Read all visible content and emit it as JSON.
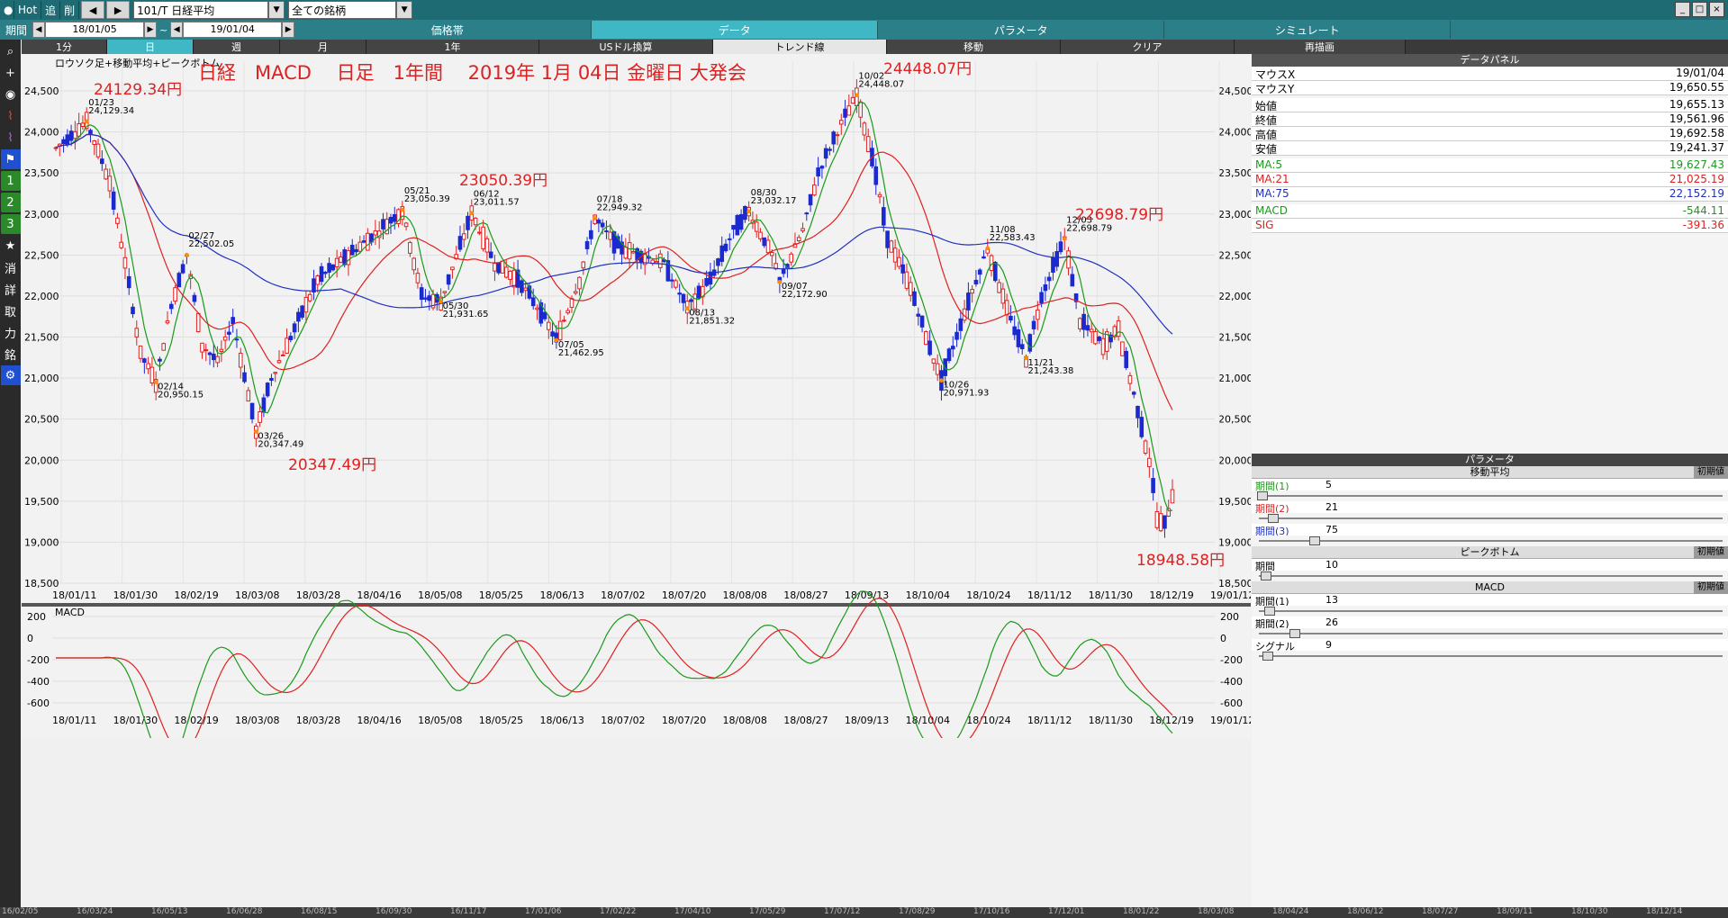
{
  "topbar": {
    "hot": "Hot",
    "add": "追",
    "del": "削",
    "symbol": "101/T 日経平均",
    "universe": "全ての銘柄",
    "win_min": "_",
    "win_max": "□",
    "win_close": "×"
  },
  "row2": {
    "period_label": "期間",
    "start_date": "18/01/05",
    "tilde": "~",
    "end_date": "19/01/04",
    "tabs": [
      "価格帯",
      "データ",
      "パラメータ",
      "シミュレート"
    ],
    "active_tab": 1
  },
  "row3": {
    "tabs": [
      "1分",
      "日",
      "週",
      "月",
      "1年",
      "USドル換算",
      "トレンド線",
      "移動",
      "クリア",
      "再描画"
    ],
    "active_tab": 1
  },
  "sidebar": {
    "icons": [
      "search-icon",
      "plus-icon",
      "camera-icon",
      "chart-icon",
      "chart-alt-icon",
      "flag-icon",
      "1",
      "2",
      "3",
      "star-icon",
      "消",
      "詳",
      "取",
      "力",
      "銘",
      "gear-icon"
    ]
  },
  "chart": {
    "legend": "ロウソク足+移動平均+ピークボトム",
    "title": "日経　MACD　 日足　1年間　 2019年 1月 04日 金曜日 大発会",
    "macd_label": "MACD",
    "big_labels": [
      {
        "text": "24129.34円",
        "color": "#e02020"
      },
      {
        "text": "20347.49円",
        "color": "#e02020"
      },
      {
        "text": "23050.39円",
        "color": "#e02020"
      },
      {
        "text": "24448.07円",
        "color": "#e02020"
      },
      {
        "text": "22698.79円",
        "color": "#e02020"
      },
      {
        "text": "18948.58円",
        "color": "#e02020"
      }
    ],
    "peaks": [
      {
        "date": "01/23",
        "value": "24,129.34"
      },
      {
        "date": "02/14",
        "value": "20,950.15"
      },
      {
        "date": "02/27",
        "value": "22,502.05"
      },
      {
        "date": "03/26",
        "value": "20,347.49"
      },
      {
        "date": "05/21",
        "value": "23,050.39"
      },
      {
        "date": "05/30",
        "value": "21,931.65"
      },
      {
        "date": "06/12",
        "value": "23,011.57"
      },
      {
        "date": "07/05",
        "value": "21,462.95"
      },
      {
        "date": "07/18",
        "value": "22,949.32"
      },
      {
        "date": "08/13",
        "value": "21,851.32"
      },
      {
        "date": "08/30",
        "value": "23,032.17"
      },
      {
        "date": "09/07",
        "value": "22,172.90"
      },
      {
        "date": "10/02",
        "value": "24,448.07"
      },
      {
        "date": "10/26",
        "value": "20,971.93"
      },
      {
        "date": "11/08",
        "value": "22,583.43"
      },
      {
        "date": "11/21",
        "value": "21,243.38"
      },
      {
        "date": "12/03",
        "value": "22,698.79"
      }
    ],
    "y_ticks": [
      "24,500",
      "24,000",
      "23,500",
      "23,000",
      "22,500",
      "22,000",
      "21,500",
      "21,000",
      "20,500",
      "20,000",
      "19,500",
      "19,000",
      "18,500"
    ],
    "x_ticks": [
      "18/01/11",
      "18/01/30",
      "18/02/19",
      "18/03/08",
      "18/03/28",
      "18/04/16",
      "18/05/08",
      "18/05/25",
      "18/06/13",
      "18/07/02",
      "18/07/20",
      "18/08/08",
      "18/08/27",
      "18/09/13",
      "18/10/04",
      "18/10/24",
      "18/11/12",
      "18/11/30",
      "18/12/19",
      "19/01/12"
    ],
    "macd_y_ticks": [
      "200",
      "0",
      "-200",
      "-400",
      "-600"
    ]
  },
  "data_panel": {
    "title": "データパネル",
    "rows": [
      {
        "label": "マウスX",
        "value": "19/01/04",
        "color": "#000000"
      },
      {
        "label": "マウスY",
        "value": "19,650.55",
        "color": "#000000"
      },
      {
        "label": "始値",
        "value": "19,655.13",
        "color": "#000000"
      },
      {
        "label": "終値",
        "value": "19,561.96",
        "color": "#000000"
      },
      {
        "label": "高値",
        "value": "19,692.58",
        "color": "#000000"
      },
      {
        "label": "安値",
        "value": "19,241.37",
        "color": "#000000"
      },
      {
        "label": "MA:5",
        "value": "19,627.43",
        "color": "#1a9a1a"
      },
      {
        "label": "MA:21",
        "value": "21,025.19",
        "color": "#e02020"
      },
      {
        "label": "MA:75",
        "value": "22,152.19",
        "color": "#2030c0"
      },
      {
        "label": "MACD",
        "value": "-544.11",
        "color": "#1a9a1a"
      },
      {
        "label": "SIG",
        "value": "-391.36",
        "color": "#e02020"
      }
    ]
  },
  "params": {
    "title": "パラメータ",
    "ma_title": "移動平均",
    "init_label": "初期値",
    "ma_rows": [
      {
        "label": "期間(1)",
        "value": "5",
        "color": "#1a9a1a"
      },
      {
        "label": "期間(2)",
        "value": "21",
        "color": "#e02020"
      },
      {
        "label": "期間(3)",
        "value": "75",
        "color": "#2030c0"
      }
    ],
    "pb_title": "ピークボトム",
    "pb_rows": [
      {
        "label": "期間",
        "value": "10",
        "color": "#000000"
      }
    ],
    "macd_title": "MACD",
    "macd_rows": [
      {
        "label": "期間(1)",
        "value": "13",
        "color": "#000000"
      },
      {
        "label": "期間(2)",
        "value": "26",
        "color": "#000000"
      },
      {
        "label": "シグナル",
        "value": "9",
        "color": "#000000"
      }
    ]
  },
  "bottom_strip": {
    "dates": [
      "16/02/05",
      "16/03/24",
      "16/05/13",
      "16/06/28",
      "16/08/15",
      "16/09/30",
      "16/11/17",
      "17/01/06",
      "17/02/22",
      "17/04/10",
      "17/05/29",
      "17/07/12",
      "17/08/29",
      "17/10/16",
      "17/12/01",
      "18/01/22",
      "18/03/08",
      "18/04/24",
      "18/06/12",
      "18/07/27",
      "18/09/11",
      "18/10/30",
      "18/12/14"
    ]
  }
}
